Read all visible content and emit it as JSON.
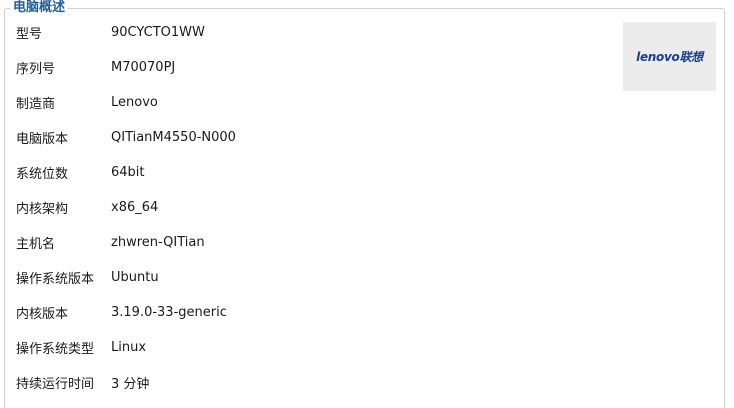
{
  "section": {
    "title": "电脑概述"
  },
  "logo": {
    "brand": "lenovo联想",
    "color": "#1b3f8f"
  },
  "rows": [
    {
      "label": "型号",
      "value": "90CYCTO1WW"
    },
    {
      "label": "序列号",
      "value": "M70070PJ"
    },
    {
      "label": "制造商",
      "value": "Lenovo"
    },
    {
      "label": "电脑版本",
      "value": "QITianM4550-N000"
    },
    {
      "label": "系统位数",
      "value": "64bit"
    },
    {
      "label": "内核架构",
      "value": "x86_64"
    },
    {
      "label": "主机名",
      "value": "zhwren-QITian"
    },
    {
      "label": "操作系统版本",
      "value": "Ubuntu"
    },
    {
      "label": "内核版本",
      "value": "3.19.0-33-generic"
    },
    {
      "label": "操作系统类型",
      "value": "Linux"
    },
    {
      "label": "持续运行时间",
      "value": "3 分钟"
    }
  ],
  "colors": {
    "title": "#1f5f9f",
    "border": "#cfcfcf",
    "logo_bg": "#ececec"
  }
}
